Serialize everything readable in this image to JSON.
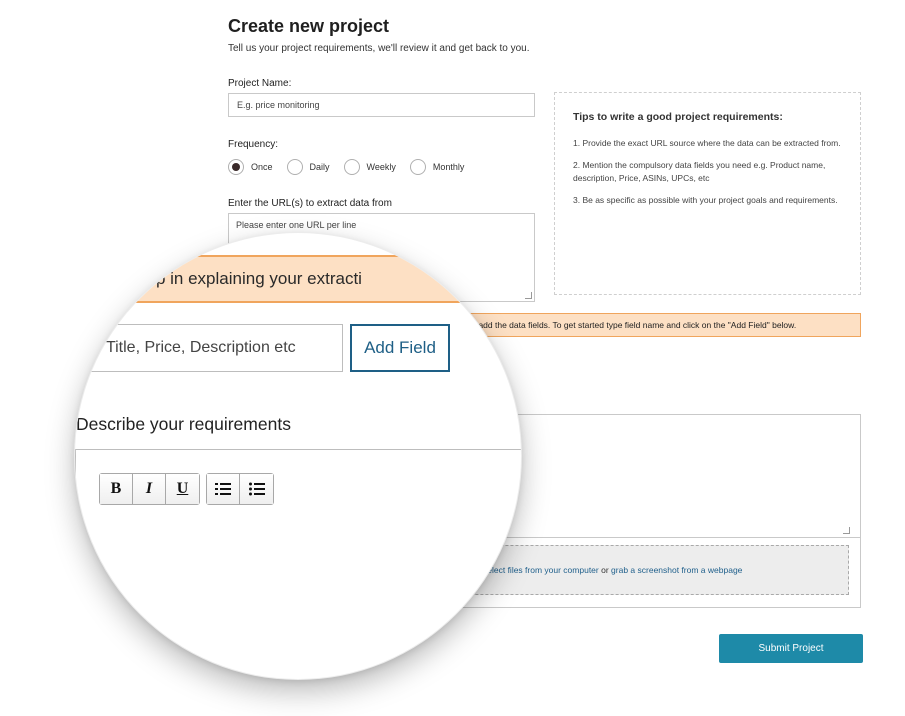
{
  "header": {
    "title": "Create new project",
    "subtitle": "Tell us your project requirements, we'll review it and get back to you."
  },
  "project_name": {
    "label": "Project Name:",
    "placeholder": "E.g. price monitoring"
  },
  "frequency": {
    "label": "Frequency:",
    "options": [
      "Once",
      "Daily",
      "Weekly",
      "Monthly"
    ],
    "selected": "Once"
  },
  "urls": {
    "label": "Enter the URL(s) to extract data from",
    "placeholder": "Please enter one URL per line"
  },
  "tips": {
    "title": "Tips to write a good project requirements:",
    "items": [
      "1. Provide the exact URL source where the data can be extracted from.",
      "2. Mention the compulsory data fields you need e.g. Product name, description, Price, ASINs, UPCs, etc",
      "3. Be as specific as possible with your project goals and requirements."
    ]
  },
  "banner": {
    "text": "to add the data fields. To get started type field name and click on the \"Add Field\" below."
  },
  "upload": {
    "link1": "select files from your computer",
    "or": "or",
    "link2": "grab a screenshot from a webpage"
  },
  "submit_label": "Submit Project",
  "magnifier": {
    "banner_text": "e first step in explaining your extracti",
    "field_placeholder": ".g. Title, Price, Description etc",
    "add_field_label": "Add Field",
    "describe_heading": "Describe your requirements",
    "toolbar": {
      "bold": "B",
      "italic": "I",
      "underline": "U"
    }
  },
  "colors": {
    "banner_bg": "#fde0c4",
    "banner_border": "#f0a55d",
    "submit_bg": "#1e8aa8",
    "add_field": "#1e5f86",
    "link": "#1f5f8b"
  }
}
